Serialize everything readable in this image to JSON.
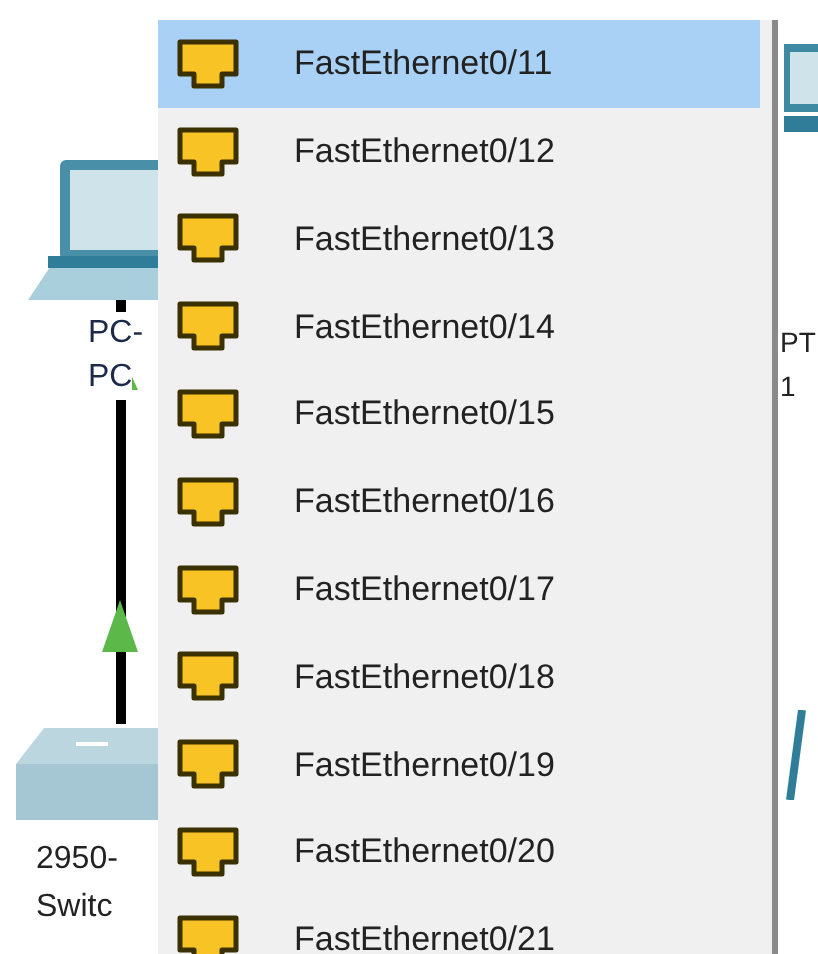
{
  "canvas": {
    "devices": [
      {
        "kind": "pc",
        "labels": [
          "PC-",
          "PC"
        ]
      },
      {
        "kind": "switch",
        "labels": [
          "2950-",
          "Switc"
        ]
      },
      {
        "kind": "pc_right",
        "labels": [
          "PT",
          "1"
        ]
      }
    ]
  },
  "port_menu": {
    "items": [
      {
        "label": "FastEthernet0/11",
        "selected": true
      },
      {
        "label": "FastEthernet0/12",
        "selected": false
      },
      {
        "label": "FastEthernet0/13",
        "selected": false
      },
      {
        "label": "FastEthernet0/14",
        "selected": false
      },
      {
        "label": "FastEthernet0/15",
        "selected": false
      },
      {
        "label": "FastEthernet0/16",
        "selected": false
      },
      {
        "label": "FastEthernet0/17",
        "selected": false
      },
      {
        "label": "FastEthernet0/18",
        "selected": false
      },
      {
        "label": "FastEthernet0/19",
        "selected": false
      },
      {
        "label": "FastEthernet0/20",
        "selected": false
      },
      {
        "label": "FastEthernet0/21",
        "selected": false
      }
    ]
  }
}
